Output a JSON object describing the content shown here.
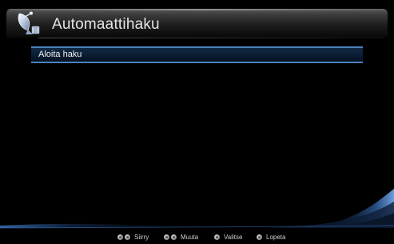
{
  "header": {
    "title": "Automaattihaku",
    "icon": "satellite-dish-icon"
  },
  "menu": {
    "items": [
      {
        "label": "Aloita haku",
        "selected": true
      }
    ]
  },
  "footer": {
    "hints": [
      {
        "label": "Siirry",
        "icons": [
          "up-button-icon",
          "down-button-icon"
        ]
      },
      {
        "label": "Muuta",
        "icons": [
          "left-button-icon",
          "right-button-icon"
        ]
      },
      {
        "label": "Valitse",
        "icons": [
          "ok-button-icon"
        ]
      },
      {
        "label": "Lopeta",
        "icons": [
          "exit-button-icon"
        ]
      }
    ]
  },
  "colors": {
    "background": "#000000",
    "selection_border": "#4b82bd",
    "selection_fill": "#0a1b31",
    "accent_swoosh": "#2a5a9a"
  }
}
